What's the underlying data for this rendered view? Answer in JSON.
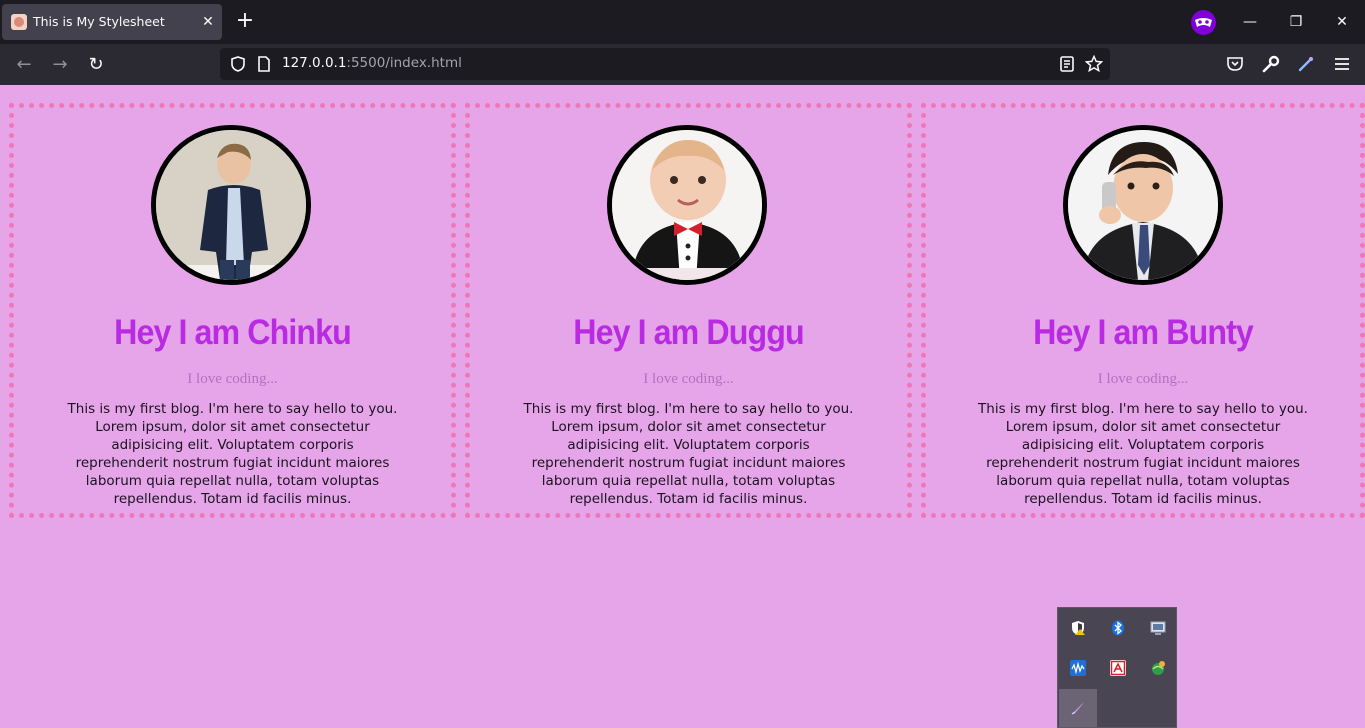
{
  "browser": {
    "tab": {
      "title": "This is My Stylesheet"
    },
    "url": {
      "host": "127.0.0.1",
      "rest": ":5500/index.html"
    },
    "icons": [
      "back-icon",
      "forward-icon",
      "reload-icon",
      "shield-icon",
      "page-icon",
      "reader-view-icon",
      "bookmark-star-icon",
      "pocket-icon",
      "wrench-icon",
      "theme-brush-icon",
      "menu-icon",
      "private-mask-icon",
      "minimize-icon",
      "restore-icon",
      "close-icon"
    ]
  },
  "cards": [
    {
      "title": "Hey I am Chinku",
      "subtitle": "I love coding...",
      "text": "This is my first blog. I'm here to say hello to you. Lorem ipsum, dolor sit amet consectetur adipisicing elit. Voluptatem corporis reprehenderit nostrum fugiat incidunt maiores laborum quia repellat nulla, totam voluptas repellendus. Totam id facilis minus."
    },
    {
      "title": "Hey I am Duggu",
      "subtitle": "I love coding...",
      "text": "This is my first blog. I'm here to say hello to you. Lorem ipsum, dolor sit amet consectetur adipisicing elit. Voluptatem corporis reprehenderit nostrum fugiat incidunt maiores laborum quia repellat nulla, totam voluptas repellendus. Totam id facilis minus."
    },
    {
      "title": "Hey I am Bunty",
      "subtitle": "I love coding...",
      "text": "This is my first blog. I'm here to say hello to you. Lorem ipsum, dolor sit amet consectetur adipisicing elit. Voluptatem corporis reprehenderit nostrum fugiat incidunt maiores laborum quia repellat nulla, totam voluptas repellendus. Totam id facilis minus."
    }
  ],
  "colors": {
    "page_bg": "#e6a5e8",
    "border": "#ef77b8",
    "title": "#b82be3",
    "subtitle": "#b56fc3"
  },
  "tray": {
    "icons": [
      "security-warning-icon",
      "bluetooth-icon",
      "display-icon",
      "audio-icon",
      "acrobat-icon",
      "network-icon",
      "pen-icon"
    ]
  }
}
